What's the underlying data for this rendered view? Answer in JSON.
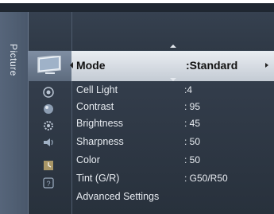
{
  "side_tab": {
    "label": "Picture"
  },
  "selected": {
    "label": "Mode",
    "value": ":Standard"
  },
  "items": [
    {
      "label": "Cell Light",
      "value": ":4"
    },
    {
      "label": "Contrast",
      "value": ": 95"
    },
    {
      "label": "Brightness",
      "value": ": 45"
    },
    {
      "label": "Sharpness",
      "value": ": 50"
    },
    {
      "label": "Color",
      "value": ": 50"
    },
    {
      "label": "Tint (G/R)",
      "value": ": G50/R50"
    },
    {
      "label": "Advanced Settings",
      "value": ""
    }
  ],
  "icons": [
    "picture-tv-icon",
    "circle-icon",
    "sphere-icon",
    "gear-icon",
    "speaker-icon",
    "timer-icon",
    "help-icon"
  ]
}
